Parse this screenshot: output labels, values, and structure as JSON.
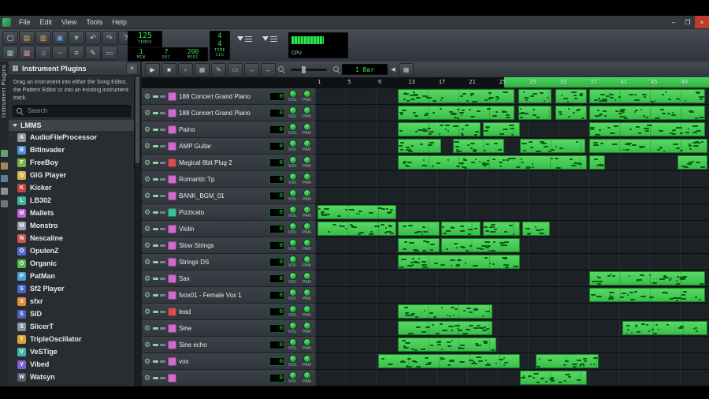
{
  "window": {
    "minimize": "–",
    "maximize": "❐",
    "close": "×"
  },
  "menu_bar": {
    "items": [
      "File",
      "Edit",
      "View",
      "Tools",
      "Help"
    ]
  },
  "main_toolbar": {
    "row1": [
      {
        "name": "new-project",
        "glyph": "▢",
        "color": "#dfe4e8"
      },
      {
        "name": "open-project",
        "glyph": "▤",
        "color": "#e2b84e"
      },
      {
        "name": "open-recent",
        "glyph": "▥",
        "color": "#e2b84e"
      },
      {
        "name": "save-project",
        "glyph": "▣",
        "color": "#6aa2df"
      },
      {
        "name": "export-project",
        "glyph": "▼",
        "color": "#79c879"
      },
      {
        "name": "undo",
        "glyph": "↶",
        "color": "#c8ced4"
      },
      {
        "name": "redo",
        "glyph": "↷",
        "color": "#c8ced4"
      },
      {
        "name": "whats-this",
        "glyph": "?",
        "color": "#c8ced4"
      }
    ],
    "row2": [
      {
        "name": "song-editor-toggle",
        "glyph": "▦",
        "color": "#8fd08f"
      },
      {
        "name": "bb-editor-toggle",
        "glyph": "▩",
        "color": "#d08f8f"
      },
      {
        "name": "piano-roll-toggle",
        "glyph": "♫",
        "color": "#8fb8d8"
      },
      {
        "name": "automation-editor-toggle",
        "glyph": "~",
        "color": "#d0b88f"
      },
      {
        "name": "fx-mixer-toggle",
        "glyph": "≡",
        "color": "#d0c88f"
      },
      {
        "name": "project-notes-toggle",
        "glyph": "✎",
        "color": "#d0d08f"
      },
      {
        "name": "controller-rack-toggle",
        "glyph": "▭",
        "color": "#a8b0b8"
      }
    ]
  },
  "lcd": {
    "tempo_value": "125",
    "tempo_label": "TEMPO",
    "min_value": "1",
    "min_label": "MIN",
    "sec_value": "7",
    "sec_label": "SEC",
    "msec_value": "200",
    "msec_label": "MSEC",
    "timesig_num": "4",
    "timesig_den": "4",
    "timesig_label": "TIME SIG"
  },
  "cpu": {
    "label": "CPU"
  },
  "sidebar": {
    "vertical_label": "Instrument Plugins",
    "tabs": [
      {
        "id": "instruments",
        "color": "#6a9f6e"
      },
      {
        "id": "samples",
        "color": "#9f8a5a"
      },
      {
        "id": "presets",
        "color": "#5a7f9f"
      },
      {
        "id": "home",
        "color": "#8a8f95"
      },
      {
        "id": "computer",
        "color": "#6f757b"
      }
    ]
  },
  "plugin_panel": {
    "title": "Instrument Plugins",
    "description": "Drag an instrument into either the Song Editor, the Pattern Editor or into an existing instrument track.",
    "search_placeholder": "Search",
    "root_label": "LMMS",
    "items": [
      {
        "name": "AudioFileProcessor",
        "color": "#8f979e"
      },
      {
        "name": "BitInvader",
        "color": "#4f8fd6"
      },
      {
        "name": "FreeBoy",
        "color": "#7fb04f"
      },
      {
        "name": "GIG Player",
        "color": "#d6b44f"
      },
      {
        "name": "Kicker",
        "color": "#c04545"
      },
      {
        "name": "LB302",
        "color": "#3fb3a0"
      },
      {
        "name": "Mallets",
        "color": "#c05fd0"
      },
      {
        "name": "Monstro",
        "color": "#9aa2ab"
      },
      {
        "name": "Nescaline",
        "color": "#d05454"
      },
      {
        "name": "OpulenZ",
        "color": "#5468d0"
      },
      {
        "name": "Organic",
        "color": "#55b84f"
      },
      {
        "name": "PatMan",
        "color": "#4f9fd6"
      },
      {
        "name": "Sf2 Player",
        "color": "#4468c8"
      },
      {
        "name": "sfxr",
        "color": "#e08a3a"
      },
      {
        "name": "SID",
        "color": "#4f5fc0"
      },
      {
        "name": "SlicerT",
        "color": "#8a929a"
      },
      {
        "name": "TripleOscillator",
        "color": "#e0a23a"
      },
      {
        "name": "VeSTige",
        "color": "#3fb8a8"
      },
      {
        "name": "Vibed",
        "color": "#7a5fd0"
      },
      {
        "name": "Watsyn",
        "color": "#55606c"
      }
    ]
  },
  "song_editor": {
    "toolbar": {
      "buttons": [
        {
          "name": "play",
          "glyph": "▶",
          "color": "#d2d9de"
        },
        {
          "name": "stop",
          "glyph": "■",
          "color": "#d2d9de"
        },
        {
          "name": "record",
          "glyph": "●",
          "color": "#c85050"
        },
        {
          "name": "add-track",
          "glyph": "▦",
          "color": "#b8c0c6"
        },
        {
          "name": "draw-mode",
          "glyph": "✎",
          "color": "#b8c0c6"
        },
        {
          "name": "edit-mode",
          "glyph": "▭",
          "color": "#b8c0c6"
        },
        {
          "name": "next-mode",
          "glyph": "→",
          "color": "#b8c0c6"
        },
        {
          "name": "stretch-mode",
          "glyph": "↔",
          "color": "#b8c0c6"
        }
      ],
      "zoom_value": "1 Bar",
      "arrow_left": "◀",
      "grid_button_glyph": "▦"
    },
    "timeline": {
      "labels": [
        "1",
        "5",
        "9",
        "13",
        "17",
        "21",
        "25",
        "29",
        "33",
        "37",
        "41",
        "45",
        "49"
      ],
      "loop": {
        "start": 0.48,
        "end": 1.0
      }
    },
    "vol_label": "VOL",
    "pan_label": "PAN",
    "tracks": [
      {
        "name": "188 Concert Grand Piano",
        "icon_color": "#cf6bd0",
        "lcd": "0",
        "segments": [
          [
            0.21,
            0.295
          ],
          [
            0.515,
            0.085
          ],
          [
            0.61,
            0.08
          ],
          [
            0.695,
            0.295
          ]
        ]
      },
      {
        "name": "188 Concert Grand Piano",
        "icon_color": "#cf6bd0",
        "lcd": "0",
        "segments": [
          [
            0.21,
            0.295
          ],
          [
            0.515,
            0.085
          ],
          [
            0.61,
            0.08
          ],
          [
            0.695,
            0.295
          ]
        ]
      },
      {
        "name": "Paino",
        "icon_color": "#cf6bd0",
        "lcd": "0",
        "segments": [
          [
            0.21,
            0.21
          ],
          [
            0.425,
            0.095
          ],
          [
            0.695,
            0.295
          ]
        ]
      },
      {
        "name": "AMP Guitar",
        "icon_color": "#cf6bd0",
        "lcd": "0",
        "segments": [
          [
            0.21,
            0.11
          ],
          [
            0.35,
            0.13
          ],
          [
            0.52,
            0.165
          ],
          [
            0.695,
            0.3
          ]
        ]
      },
      {
        "name": "Magical 8bit Plug 2",
        "icon_color": "#d84f4f",
        "lcd": "0",
        "segments": [
          [
            0.21,
            0.48
          ],
          [
            0.695,
            0.04
          ],
          [
            0.92,
            0.075
          ]
        ]
      },
      {
        "name": "Romantic Tp",
        "icon_color": "#cf6bd0",
        "lcd": "0",
        "segments": []
      },
      {
        "name": "BANK_BGM_01",
        "icon_color": "#cf6bd0",
        "lcd": "0",
        "segments": []
      },
      {
        "name": "Pizzicato",
        "icon_color": "#3bbf9a",
        "lcd": "0",
        "segments": [
          [
            0.005,
            0.2
          ]
        ]
      },
      {
        "name": "Violin",
        "icon_color": "#cf6bd0",
        "lcd": "0",
        "segments": [
          [
            0.005,
            0.2
          ],
          [
            0.21,
            0.105
          ],
          [
            0.32,
            0.1
          ],
          [
            0.425,
            0.095
          ],
          [
            0.525,
            0.07
          ]
        ]
      },
      {
        "name": "Slow Strings",
        "icon_color": "#cf6bd0",
        "lcd": "0",
        "segments": [
          [
            0.21,
            0.105
          ],
          [
            0.32,
            0.2
          ]
        ]
      },
      {
        "name": "Strings DS",
        "icon_color": "#cf6bd0",
        "lcd": "0",
        "segments": [
          [
            0.21,
            0.31
          ]
        ]
      },
      {
        "name": "Sax",
        "icon_color": "#cf6bd0",
        "lcd": "0",
        "segments": [
          [
            0.695,
            0.295
          ]
        ]
      },
      {
        "name": "fvox01 - Female Vox 1",
        "icon_color": "#cf6bd0",
        "lcd": "0",
        "segments": [
          [
            0.695,
            0.295
          ]
        ]
      },
      {
        "name": "lead",
        "icon_color": "#d84f4f",
        "lcd": "0",
        "segments": [
          [
            0.21,
            0.24
          ]
        ]
      },
      {
        "name": "Sine",
        "icon_color": "#cf6bd0",
        "lcd": "0",
        "segments": [
          [
            0.21,
            0.24
          ],
          [
            0.78,
            0.215
          ]
        ]
      },
      {
        "name": "Sine echo",
        "icon_color": "#cf6bd0",
        "lcd": "0",
        "segments": [
          [
            0.21,
            0.25
          ]
        ]
      },
      {
        "name": "vox",
        "icon_color": "#cf6bd0",
        "lcd": "0",
        "segments": [
          [
            0.16,
            0.36
          ],
          [
            0.56,
            0.16
          ]
        ]
      },
      {
        "name": "",
        "icon_color": "#cf6bd0",
        "lcd": "0",
        "segments": [
          [
            0.52,
            0.17
          ]
        ]
      }
    ]
  }
}
